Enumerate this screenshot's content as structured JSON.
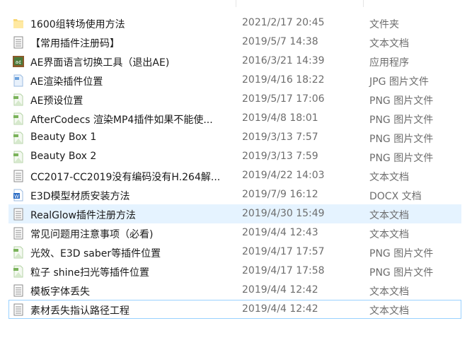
{
  "files": [
    {
      "name": "1600组转场使用方法",
      "date": "2021/2/17 20:45",
      "type": "文件夹",
      "icon": "folder-icon"
    },
    {
      "name": "【常用插件注册码】",
      "date": "2019/5/7 14:38",
      "type": "文本文档",
      "icon": "text-file-icon"
    },
    {
      "name": "AE界面语言切换工具（退出AE)",
      "date": "2016/3/21 14:39",
      "type": "应用程序",
      "icon": "application-icon"
    },
    {
      "name": "AE渲染插件位置",
      "date": "2019/4/16 18:22",
      "type": "JPG 图片文件",
      "icon": "jpg-file-icon"
    },
    {
      "name": "AE预设位置",
      "date": "2019/5/17 17:06",
      "type": "PNG 图片文件",
      "icon": "png-file-icon"
    },
    {
      "name": "AfterCodecs 渲染MP4插件如果不能使...",
      "date": "2019/4/8 18:01",
      "type": "PNG 图片文件",
      "icon": "png-file-icon"
    },
    {
      "name": "Beauty Box 1",
      "date": "2019/3/13 7:57",
      "type": "PNG 图片文件",
      "icon": "png-file-icon"
    },
    {
      "name": "Beauty Box 2",
      "date": "2019/3/13 7:59",
      "type": "PNG 图片文件",
      "icon": "png-file-icon"
    },
    {
      "name": "CC2017-CC2019没有编码没有H.264解...",
      "date": "2019/4/22 14:03",
      "type": "文本文档",
      "icon": "text-file-icon"
    },
    {
      "name": "E3D模型材质安装方法",
      "date": "2019/7/9 16:12",
      "type": "DOCX 文档",
      "icon": "docx-file-icon"
    },
    {
      "name": "RealGlow插件注册方法",
      "date": "2019/4/30 15:49",
      "type": "文本文档",
      "icon": "text-file-icon",
      "state": "hover"
    },
    {
      "name": "常见问题用注意事项（必看)",
      "date": "2019/4/4 12:43",
      "type": "文本文档",
      "icon": "text-file-icon"
    },
    {
      "name": "光效、E3D saber等插件位置",
      "date": "2019/4/17 17:57",
      "type": "PNG 图片文件",
      "icon": "png-file-icon"
    },
    {
      "name": "粒子 shine扫光等插件位置",
      "date": "2019/4/17 17:58",
      "type": "PNG 图片文件",
      "icon": "png-file-icon"
    },
    {
      "name": "模板字体丢失",
      "date": "2019/4/4 12:42",
      "type": "文本文档",
      "icon": "text-file-icon"
    },
    {
      "name": "素材丢失指认路径工程",
      "date": "2019/4/4 12:42",
      "type": "文本文档",
      "icon": "text-file-icon",
      "state": "focus"
    }
  ],
  "colors": {
    "hover": "#e5f3ff",
    "focus": "#99d1ff",
    "meta_text": "#6d6d6d"
  }
}
